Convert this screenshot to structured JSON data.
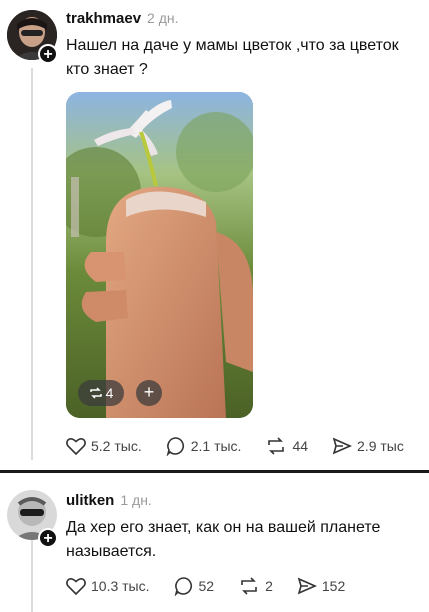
{
  "posts": [
    {
      "username": "trakhmaev",
      "time": "2 дн.",
      "text": "Нашел на даче у мамы цветок ,что за цветок кто знает ?",
      "image_badge_reposts": "4",
      "image_badge_plus": "+",
      "actions": {
        "likes": "5.2 тыс.",
        "comments": "2.1 тыс.",
        "reposts": "44",
        "shares": "2.9 тыс"
      }
    },
    {
      "username": "ulitken",
      "time": "1 дн.",
      "text": "Да хер его знает, как он на вашей планете называется.",
      "actions": {
        "likes": "10.3 тыс.",
        "comments": "52",
        "reposts": "2",
        "shares": "152"
      }
    }
  ],
  "avatar_plus": "+",
  "icons": {
    "like": "heart-icon",
    "comment": "comment-bubble-icon",
    "repost": "repost-icon",
    "share": "send-icon",
    "follow": "plus-icon"
  }
}
